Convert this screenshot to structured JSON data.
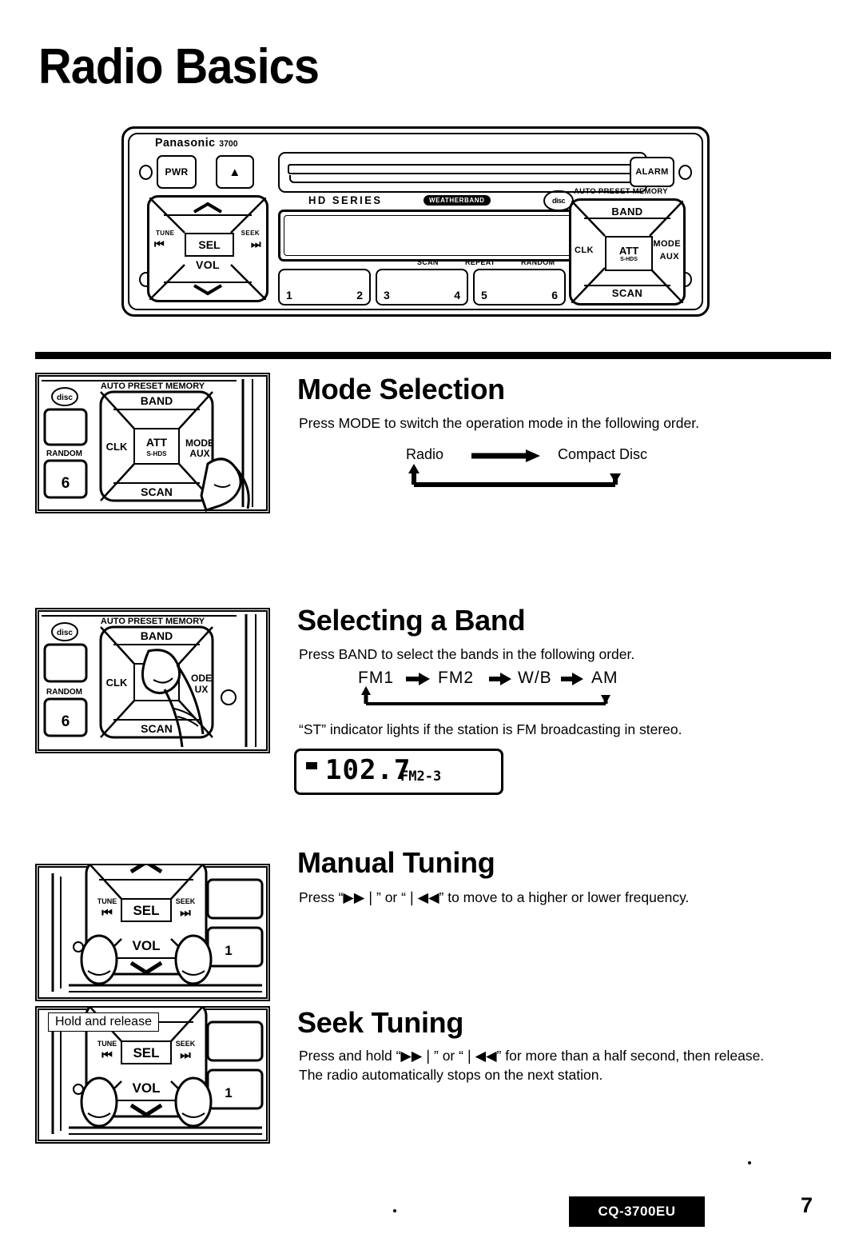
{
  "page": {
    "title": "Radio Basics",
    "number": "7",
    "model_code": "CQ-3700EU"
  },
  "unit": {
    "brand": "Panasonic",
    "model": "3700",
    "power_button": "PWR",
    "eject_button": "▲",
    "alarm_button": "ALARM",
    "series_label": "HD SERIES",
    "weatherband_badge": "WEATHERBAND",
    "disc_logo": "disc",
    "left_pad": {
      "up": "▲",
      "down": "▼",
      "center": "SEL",
      "left_top": "TUNE",
      "left_bottom": "⏮",
      "right_top": "SEEK",
      "right_bottom": "⏭",
      "bottom_label": "VOL"
    },
    "right_pad": {
      "top": "BAND",
      "bottom": "SCAN",
      "left": "CLK",
      "right_top": "MODE",
      "right_bottom": "AUX",
      "center_top": "ATT",
      "center_bottom": "S-HDS",
      "header": "AUTO PRESET MEMORY"
    },
    "presets": [
      {
        "left": "1",
        "right": "2"
      },
      {
        "left": "3",
        "right": "4"
      },
      {
        "left": "5",
        "right": "6"
      }
    ],
    "function_labels": [
      "SCAN",
      "REPEAT",
      "RANDOM"
    ]
  },
  "sections": [
    {
      "id": "mode-selection",
      "heading": "Mode Selection",
      "body": "Press MODE to switch the operation mode in the following order.",
      "flow": [
        "Radio",
        "Compact Disc"
      ]
    },
    {
      "id": "selecting-a-band",
      "heading": "Selecting a Band",
      "body": "Press BAND to select the bands in the following order.",
      "flow": [
        "FM1",
        "FM2",
        "W/B",
        "AM"
      ],
      "note": "“ST” indicator lights if the station is FM broadcasting in stereo.",
      "display": {
        "frequency": "102.7",
        "band": "FM2-3",
        "stereo_indicator": "▬"
      }
    },
    {
      "id": "manual-tuning",
      "heading": "Manual Tuning",
      "body": "Press “▶▶❘” or “❘◀◀” to move to a higher or lower frequency."
    },
    {
      "id": "seek-tuning",
      "heading": "Seek Tuning",
      "body_line1": "Press and hold “▶▶❘” or “❘◀◀” for more than a half second, then release.",
      "body_line2": "The radio automatically stops on the next station.",
      "callout": "Hold and release"
    }
  ],
  "illustration_labels": {
    "auto_preset_memory": "AUTO PRESET MEMORY",
    "band": "BAND",
    "clk": "CLK",
    "att": "ATT",
    "s_hds": "S-HDS",
    "mode": "MODE",
    "aux": "AUX",
    "scan": "SCAN",
    "random": "RANDOM",
    "preset_six": "6",
    "tune": "TUNE",
    "seek": "SEEK",
    "sel": "SEL",
    "vol": "VOL",
    "preset_one": "1",
    "disc": "disc"
  }
}
